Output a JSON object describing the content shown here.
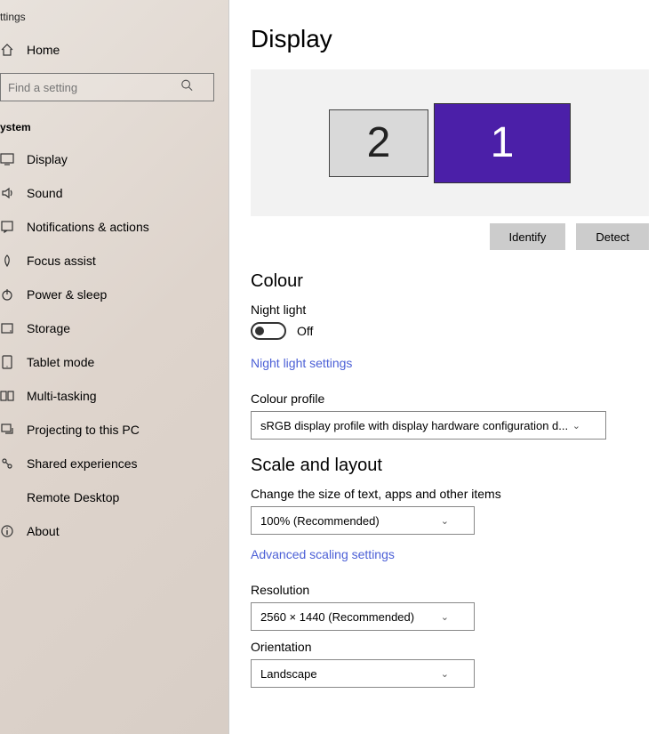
{
  "sidebar": {
    "title": "ttings",
    "home": "Home",
    "search_placeholder": "Find a setting",
    "section": "ystem",
    "items": [
      {
        "id": "display",
        "label": "Display"
      },
      {
        "id": "sound",
        "label": "Sound"
      },
      {
        "id": "notifications",
        "label": "Notifications & actions"
      },
      {
        "id": "focus",
        "label": "Focus assist"
      },
      {
        "id": "power",
        "label": "Power & sleep"
      },
      {
        "id": "storage",
        "label": "Storage"
      },
      {
        "id": "tablet",
        "label": "Tablet mode"
      },
      {
        "id": "multitask",
        "label": "Multi-tasking"
      },
      {
        "id": "projecting",
        "label": "Projecting to this PC"
      },
      {
        "id": "shared",
        "label": "Shared experiences"
      },
      {
        "id": "remote",
        "label": "Remote Desktop"
      },
      {
        "id": "about",
        "label": "About"
      }
    ]
  },
  "main": {
    "title": "Display",
    "monitors": {
      "primary": "1",
      "secondary": "2"
    },
    "identify_btn": "Identify",
    "detect_btn": "Detect",
    "colour": {
      "heading": "Colour",
      "night_light_label": "Night light",
      "night_light_state": "Off",
      "night_light_link": "Night light settings",
      "profile_label": "Colour profile",
      "profile_value": "sRGB display profile with display hardware configuration d..."
    },
    "scale": {
      "heading": "Scale and layout",
      "size_label": "Change the size of text, apps and other items",
      "size_value": "100% (Recommended)",
      "advanced_link": "Advanced scaling settings",
      "resolution_label": "Resolution",
      "resolution_value": "2560 × 1440 (Recommended)",
      "orientation_label": "Orientation",
      "orientation_value": "Landscape"
    }
  }
}
